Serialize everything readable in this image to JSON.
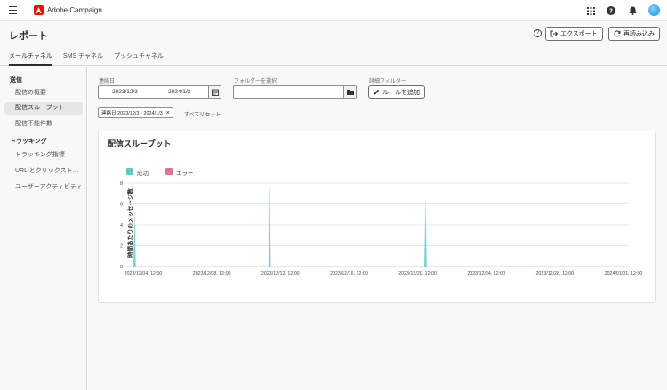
{
  "header": {
    "app_name": "Adobe Campaign",
    "icons": [
      "menu-icon",
      "adobe-logo",
      "apps-grid-icon",
      "help-icon",
      "bell-icon",
      "avatar"
    ]
  },
  "page": {
    "title": "レポート",
    "export_label": "エクスポート",
    "reload_label": "再読み込み"
  },
  "tabs": [
    "メールチャネル",
    "SMS チャネル",
    "プッシュチャネル"
  ],
  "sidebar": {
    "section_send": "送信",
    "send_items": [
      "配信の概要",
      "配信スループット",
      "配信不能件数"
    ],
    "section_tracking": "トラッキング",
    "tracking_items": [
      "トラッキング指標",
      "URL とクリックスト…",
      "ユーザーアクティビティ"
    ]
  },
  "filters": {
    "date_label": "連絡日",
    "date_from": "2023/12/3",
    "date_sep": "-",
    "date_to": "2024/1/3",
    "folder_label": "フォルダーを選択",
    "advanced_label": "詳細フィルター",
    "add_rule_label": "ルールを追加",
    "chip_label": "連絡日 2023/12/3 - 2024/1/3",
    "reset_label": "すべてリセット"
  },
  "card": {
    "title": "配信スループット"
  },
  "chart_data": {
    "type": "area",
    "ylabel": "時間あたりのメッセージ数",
    "xlabel": "",
    "ylim": [
      0,
      8
    ],
    "yticks": [
      0,
      2,
      4,
      6,
      8
    ],
    "x_ticks": [
      "2023/12/04, 12:00",
      "2023/12/08, 12:00",
      "2023/12/12, 12:00",
      "2023/12/16, 12:00",
      "2023/12/20, 12:00",
      "2023/12/24, 12:00",
      "2023/12/28, 12:00",
      "2024/01/01, 12:00"
    ],
    "grid": true,
    "legend": "top-left",
    "series": [
      {
        "name": "成功",
        "color": "#5bc9c4",
        "x": [
          "2023/12/04 00:00",
          "2023/12/11 21:00",
          "2023/12/20 23:00"
        ],
        "values": [
          5.5,
          8.0,
          6.5
        ]
      },
      {
        "name": "エラー",
        "color": "#d87599",
        "x": [],
        "values": []
      }
    ]
  }
}
